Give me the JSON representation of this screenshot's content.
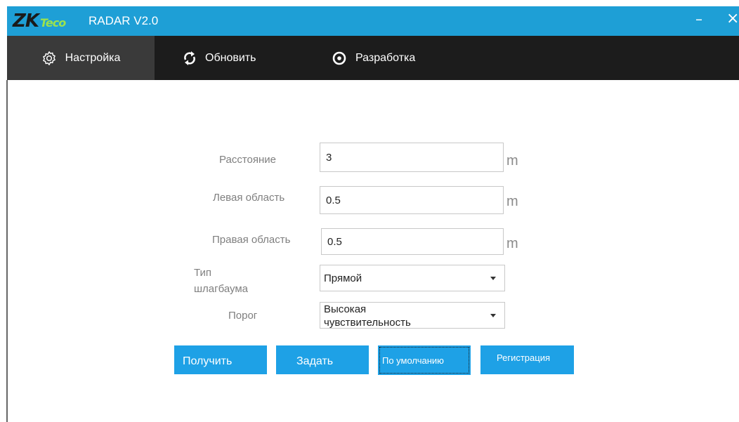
{
  "window": {
    "logo_main": "ZK",
    "logo_sub": "Teco",
    "title": "RADAR V2.0",
    "minimize_glyph": "–",
    "close_glyph": "×"
  },
  "nav": {
    "items": [
      {
        "label": "Настройка",
        "icon": "gear-icon",
        "active": true
      },
      {
        "label": "Обновить",
        "icon": "refresh-icon",
        "active": false
      },
      {
        "label": "Разработка",
        "icon": "develop-icon",
        "active": false
      }
    ]
  },
  "form": {
    "distance": {
      "label": "Расстояние",
      "value": "3",
      "unit": "m"
    },
    "left_area": {
      "label": "Левая область",
      "value": "0.5",
      "unit": "m"
    },
    "right_area": {
      "label": "Правая область",
      "value": "0.5",
      "unit": "m"
    },
    "barrier_type": {
      "label_line1": "Тип",
      "label_line2": "шлагбаума",
      "selected": "Прямой"
    },
    "threshold": {
      "label": "Порог",
      "selected_line1": "Высокая",
      "selected_line2": "чувствительность"
    }
  },
  "buttons": {
    "get": "Получить",
    "set": "Задать",
    "default": "По умолчанию",
    "register": "Регистрация"
  },
  "colors": {
    "titlebar": "#1e9fd6",
    "navbar": "#1c1c1c",
    "nav_active": "#3a3a3a",
    "button": "#1ea1e6",
    "logo_accent": "#9be24f"
  }
}
